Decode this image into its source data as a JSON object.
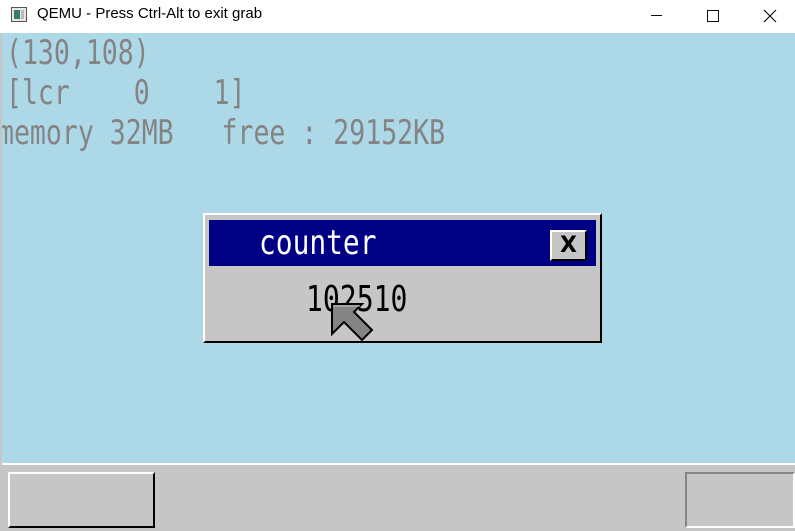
{
  "host_window": {
    "title": "QEMU - Press Ctrl-Alt to exit grab",
    "icon": "qemu-app-icon",
    "controls": [
      "minimize-icon",
      "maximize-icon",
      "close-icon"
    ]
  },
  "guest_screen": {
    "background_color": "#add8e8",
    "console": {
      "text_color": "#848484",
      "mouse_coordinates": "(130,108)",
      "mouse_buttons": "[lcr    0    1]",
      "memory_info": "memory 32MB   free : 29152KB"
    },
    "counter_window": {
      "title": "counter",
      "close_label": "X",
      "value": "102510",
      "title_bar_color": "#000084",
      "body_color": "#c6c6c6"
    },
    "taskbar": {
      "color": "#c6c6c6"
    }
  }
}
